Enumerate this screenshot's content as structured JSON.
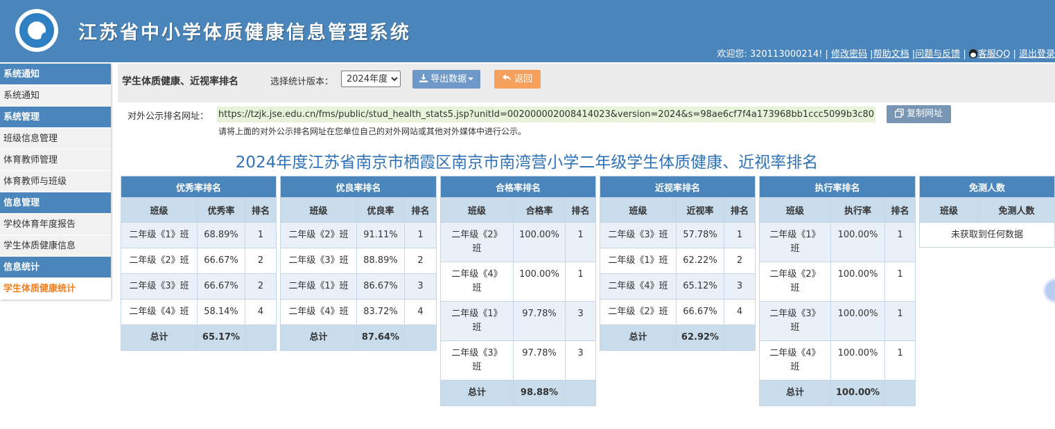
{
  "header": {
    "title": "江苏省中小学体质健康信息管理系统",
    "welcome": "欢迎您: 320113000214! |",
    "links": [
      "修改密码",
      "|帮助文档",
      "|问题与反馈",
      "|",
      "客服QQ",
      "|",
      "退出登录"
    ]
  },
  "sidebar": {
    "sections": [
      {
        "title": "系统通知",
        "items": [
          "系统通知"
        ]
      },
      {
        "title": "系统管理",
        "items": [
          "班级信息管理",
          "体育教师管理",
          "体育教师与班级"
        ]
      },
      {
        "title": "信息管理",
        "items": [
          "学校体育年度报告",
          "学生体质健康信息"
        ]
      },
      {
        "title": "信息统计",
        "items": [
          "学生体质健康统计"
        ]
      }
    ],
    "active_item": "学生体质健康统计"
  },
  "toolbar": {
    "title": "学生体质健康、近视率排名",
    "version_label": "选择统计版本：",
    "version_value": "2024年度",
    "export_label": "导出数据",
    "back_label": "返回"
  },
  "public_url": {
    "label": "对外公示排名网址：",
    "url": "https://tzjk.jse.edu.cn/fms/public/stud_health_stats5.jsp?unitId=002000002008414023&version=2024&s=98ae6cf7f4a173968bb1ccc5099b3c80",
    "copy_label": "复制网址",
    "note": "请将上面的对外公示排名网址在您单位自己的对外网站或其他对外媒体中进行公示。"
  },
  "main_title": "2024年度江苏省南京市栖霞区南京市南湾营小学二年级学生体质健康、近视率排名",
  "tables": {
    "excellent": {
      "caption": "优秀率排名",
      "headers": [
        "班级",
        "优秀率",
        "排名"
      ],
      "rows": [
        [
          "二年级《1》班",
          "68.89%",
          "1"
        ],
        [
          "二年级《2》班",
          "66.67%",
          "2"
        ],
        [
          "二年级《3》班",
          "66.67%",
          "2"
        ],
        [
          "二年级《4》班",
          "58.14%",
          "4"
        ]
      ],
      "total_label": "总计",
      "total_value": "65.17%"
    },
    "good": {
      "caption": "优良率排名",
      "headers": [
        "班级",
        "优良率",
        "排名"
      ],
      "rows": [
        [
          "二年级《2》班",
          "91.11%",
          "1"
        ],
        [
          "二年级《3》班",
          "88.89%",
          "2"
        ],
        [
          "二年级《1》班",
          "86.67%",
          "3"
        ],
        [
          "二年级《4》班",
          "83.72%",
          "4"
        ]
      ],
      "total_label": "总计",
      "total_value": "87.64%"
    },
    "pass": {
      "caption": "合格率排名",
      "headers": [
        "班级",
        "合格率",
        "排名"
      ],
      "rows": [
        [
          "二年级《2》班",
          "100.00%",
          "1"
        ],
        [
          "二年级《4》班",
          "100.00%",
          "1"
        ],
        [
          "二年级《1》班",
          "97.78%",
          "3"
        ],
        [
          "二年级《3》班",
          "97.78%",
          "3"
        ]
      ],
      "total_label": "总计",
      "total_value": "98.88%"
    },
    "myopia": {
      "caption": "近视率排名",
      "headers": [
        "班级",
        "近视率",
        "排名"
      ],
      "rows": [
        [
          "二年级《3》班",
          "57.78%",
          "1"
        ],
        [
          "二年级《1》班",
          "62.22%",
          "2"
        ],
        [
          "二年级《4》班",
          "65.12%",
          "3"
        ],
        [
          "二年级《2》班",
          "66.67%",
          "4"
        ]
      ],
      "total_label": "总计",
      "total_value": "62.92%"
    },
    "execution": {
      "caption": "执行率排名",
      "headers": [
        "班级",
        "执行率",
        "排名"
      ],
      "rows": [
        [
          "二年级《1》班",
          "100.00%",
          "1"
        ],
        [
          "二年级《2》班",
          "100.00%",
          "1"
        ],
        [
          "二年级《3》班",
          "100.00%",
          "1"
        ],
        [
          "二年级《4》班",
          "100.00%",
          "1"
        ]
      ],
      "total_label": "总计",
      "total_value": "100.00%"
    },
    "exempt": {
      "caption": "免测人数",
      "headers": [
        "班级",
        "免测人数"
      ],
      "empty_text": "未获取到任何数据"
    }
  }
}
